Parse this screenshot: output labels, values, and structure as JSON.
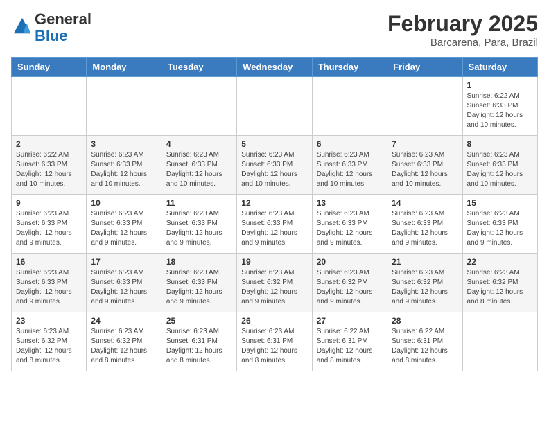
{
  "logo": {
    "general": "General",
    "blue": "Blue"
  },
  "header": {
    "month": "February 2025",
    "location": "Barcarena, Para, Brazil"
  },
  "weekdays": [
    "Sunday",
    "Monday",
    "Tuesday",
    "Wednesday",
    "Thursday",
    "Friday",
    "Saturday"
  ],
  "weeks": [
    [
      {
        "day": "",
        "info": ""
      },
      {
        "day": "",
        "info": ""
      },
      {
        "day": "",
        "info": ""
      },
      {
        "day": "",
        "info": ""
      },
      {
        "day": "",
        "info": ""
      },
      {
        "day": "",
        "info": ""
      },
      {
        "day": "1",
        "info": "Sunrise: 6:22 AM\nSunset: 6:33 PM\nDaylight: 12 hours and 10 minutes."
      }
    ],
    [
      {
        "day": "2",
        "info": "Sunrise: 6:22 AM\nSunset: 6:33 PM\nDaylight: 12 hours and 10 minutes."
      },
      {
        "day": "3",
        "info": "Sunrise: 6:23 AM\nSunset: 6:33 PM\nDaylight: 12 hours and 10 minutes."
      },
      {
        "day": "4",
        "info": "Sunrise: 6:23 AM\nSunset: 6:33 PM\nDaylight: 12 hours and 10 minutes."
      },
      {
        "day": "5",
        "info": "Sunrise: 6:23 AM\nSunset: 6:33 PM\nDaylight: 12 hours and 10 minutes."
      },
      {
        "day": "6",
        "info": "Sunrise: 6:23 AM\nSunset: 6:33 PM\nDaylight: 12 hours and 10 minutes."
      },
      {
        "day": "7",
        "info": "Sunrise: 6:23 AM\nSunset: 6:33 PM\nDaylight: 12 hours and 10 minutes."
      },
      {
        "day": "8",
        "info": "Sunrise: 6:23 AM\nSunset: 6:33 PM\nDaylight: 12 hours and 10 minutes."
      }
    ],
    [
      {
        "day": "9",
        "info": "Sunrise: 6:23 AM\nSunset: 6:33 PM\nDaylight: 12 hours and 9 minutes."
      },
      {
        "day": "10",
        "info": "Sunrise: 6:23 AM\nSunset: 6:33 PM\nDaylight: 12 hours and 9 minutes."
      },
      {
        "day": "11",
        "info": "Sunrise: 6:23 AM\nSunset: 6:33 PM\nDaylight: 12 hours and 9 minutes."
      },
      {
        "day": "12",
        "info": "Sunrise: 6:23 AM\nSunset: 6:33 PM\nDaylight: 12 hours and 9 minutes."
      },
      {
        "day": "13",
        "info": "Sunrise: 6:23 AM\nSunset: 6:33 PM\nDaylight: 12 hours and 9 minutes."
      },
      {
        "day": "14",
        "info": "Sunrise: 6:23 AM\nSunset: 6:33 PM\nDaylight: 12 hours and 9 minutes."
      },
      {
        "day": "15",
        "info": "Sunrise: 6:23 AM\nSunset: 6:33 PM\nDaylight: 12 hours and 9 minutes."
      }
    ],
    [
      {
        "day": "16",
        "info": "Sunrise: 6:23 AM\nSunset: 6:33 PM\nDaylight: 12 hours and 9 minutes."
      },
      {
        "day": "17",
        "info": "Sunrise: 6:23 AM\nSunset: 6:33 PM\nDaylight: 12 hours and 9 minutes."
      },
      {
        "day": "18",
        "info": "Sunrise: 6:23 AM\nSunset: 6:33 PM\nDaylight: 12 hours and 9 minutes."
      },
      {
        "day": "19",
        "info": "Sunrise: 6:23 AM\nSunset: 6:32 PM\nDaylight: 12 hours and 9 minutes."
      },
      {
        "day": "20",
        "info": "Sunrise: 6:23 AM\nSunset: 6:32 PM\nDaylight: 12 hours and 9 minutes."
      },
      {
        "day": "21",
        "info": "Sunrise: 6:23 AM\nSunset: 6:32 PM\nDaylight: 12 hours and 9 minutes."
      },
      {
        "day": "22",
        "info": "Sunrise: 6:23 AM\nSunset: 6:32 PM\nDaylight: 12 hours and 8 minutes."
      }
    ],
    [
      {
        "day": "23",
        "info": "Sunrise: 6:23 AM\nSunset: 6:32 PM\nDaylight: 12 hours and 8 minutes."
      },
      {
        "day": "24",
        "info": "Sunrise: 6:23 AM\nSunset: 6:32 PM\nDaylight: 12 hours and 8 minutes."
      },
      {
        "day": "25",
        "info": "Sunrise: 6:23 AM\nSunset: 6:31 PM\nDaylight: 12 hours and 8 minutes."
      },
      {
        "day": "26",
        "info": "Sunrise: 6:23 AM\nSunset: 6:31 PM\nDaylight: 12 hours and 8 minutes."
      },
      {
        "day": "27",
        "info": "Sunrise: 6:22 AM\nSunset: 6:31 PM\nDaylight: 12 hours and 8 minutes."
      },
      {
        "day": "28",
        "info": "Sunrise: 6:22 AM\nSunset: 6:31 PM\nDaylight: 12 hours and 8 minutes."
      },
      {
        "day": "",
        "info": ""
      }
    ]
  ]
}
